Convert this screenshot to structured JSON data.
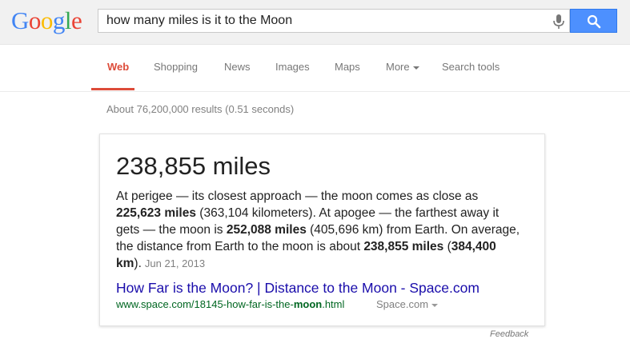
{
  "header": {
    "logo": [
      "G",
      "o",
      "o",
      "g",
      "l",
      "e"
    ],
    "logo_colors": [
      "#4285f4",
      "#ea4335",
      "#fbbc05",
      "#4285f4",
      "#34a853",
      "#ea4335"
    ],
    "query": "how many miles is it to the Moon",
    "accent": "#4d90fe"
  },
  "tabs": {
    "web": "Web",
    "shopping": "Shopping",
    "news": "News",
    "images": "Images",
    "maps": "Maps",
    "more": "More",
    "tools": "Search tools",
    "active_color": "#dd4b39"
  },
  "stats": "About 76,200,000 results (0.51 seconds)",
  "answer": {
    "headline": "238,855 miles",
    "snippet": [
      {
        "text": "At perigee — its closest approach — the moon comes as close as ",
        "bold": false
      },
      {
        "text": "225,623 miles",
        "bold": true
      },
      {
        "text": " (363,104 kilometers). At apogee — the farthest away it gets — the moon is ",
        "bold": false
      },
      {
        "text": "252,088 miles",
        "bold": true
      },
      {
        "text": " (405,696 km) from Earth. On average, the distance from Earth to the moon is about ",
        "bold": false
      },
      {
        "text": "238,855 miles",
        "bold": true
      },
      {
        "text": " (",
        "bold": false
      },
      {
        "text": "384,400 km",
        "bold": true
      },
      {
        "text": ").",
        "bold": false
      }
    ],
    "date": "Jun 21, 2013",
    "result_title": "How Far is the Moon? | Distance to the Moon - Space.com",
    "result_url_prefix": "www.space.com/18145-how-far-is-the-",
    "result_url_bold": "moon",
    "result_url_suffix": ".html",
    "site": "Space.com"
  },
  "feedback": "Feedback"
}
